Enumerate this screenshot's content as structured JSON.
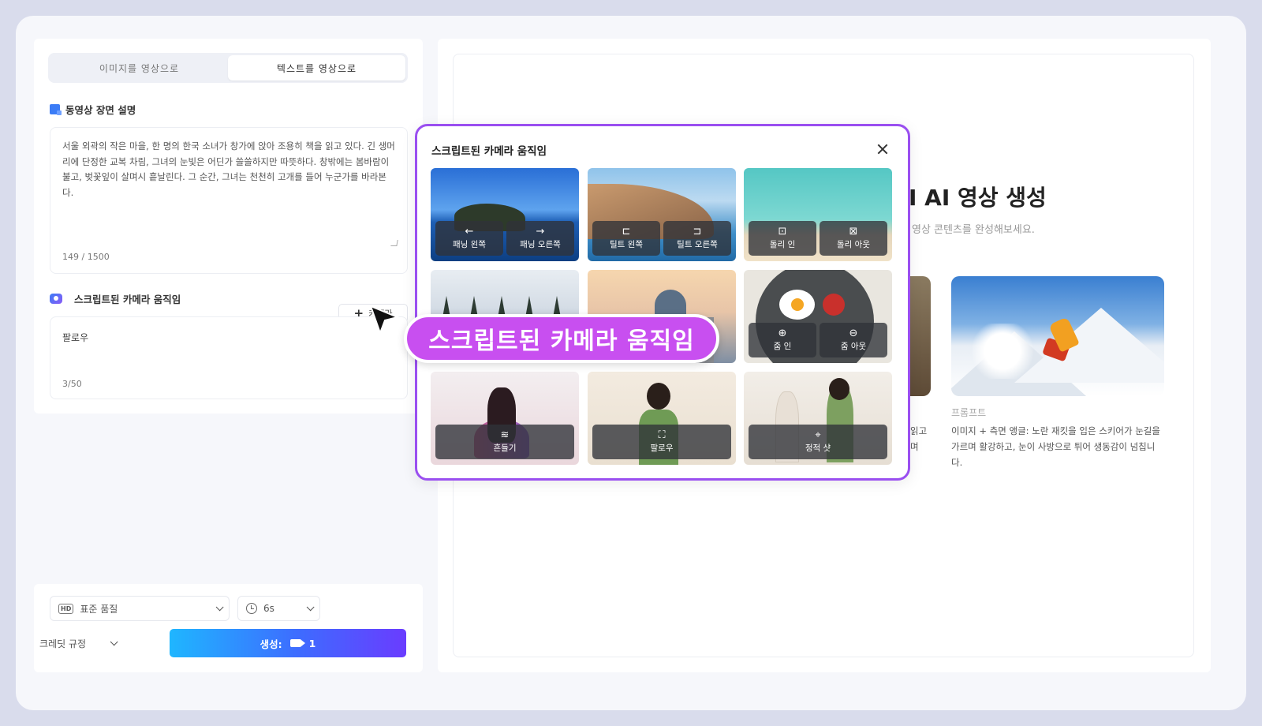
{
  "tabs": [
    "이미지를 영상으로",
    "텍스트를 영상으로"
  ],
  "scene": {
    "title": "동영상 장면 설명",
    "text": "서울 외곽의 작은 마을, 한 명의 한국 소녀가 창가에 앉아 조용히 책을 읽고 있다. 긴 생머리에 단정한 교복 차림, 그녀의 눈빛은 어딘가 쓸쓸하지만 따뜻하다. 창밖에는 봄바람이 불고, 벚꽃잎이 살며시 흩날린다. 그 순간, 그녀는 천천히 고개를 들어 누군가를 바라본다.",
    "counter": "149 / 1500"
  },
  "camera": {
    "title": "스크립트된 카메라 움직임",
    "button": "카메라",
    "value": "팔로우",
    "counter": "3/50"
  },
  "controls": {
    "quality_icon": "HD",
    "quality": "표준 품질",
    "duration": "6s",
    "credit": "크레딧 규정",
    "generate": "생성:",
    "cost": "1"
  },
  "right": {
    "title": "I AI 영상 생성",
    "subtitle": "영상 콘텐츠를 완성해보세요.",
    "prompt_label": "프롬프트",
    "prompt_text": "이미지 + 측면 앵글: 노란 재킷을 입은 스키어가 눈길을 가르며 활강하고, 눈이 사방으로 튀어 생동감이 넘칩니다.",
    "prompt_frag1": "읽고",
    "prompt_frag2": "며"
  },
  "modal": {
    "title": "스크립트된 카메라 움직임",
    "options": {
      "pan_left": "패닝 왼쪽",
      "pan_right": "패닝 오른쪽",
      "tilt_left": "틸트 왼쪽",
      "tilt_right": "틸트 오른쪽",
      "dolly_in": "돌리 인",
      "dolly_out": "돌리 아웃",
      "zoom_in": "줌 인",
      "zoom_out": "줌 아웃",
      "shake": "흔들기",
      "follow": "팔로우",
      "static": "정적 샷"
    }
  },
  "callout": "스크립트된 카메라 움직임"
}
